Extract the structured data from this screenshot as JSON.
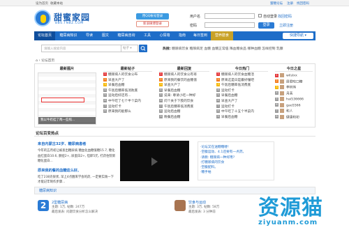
{
  "topbar": {
    "set_home": "设为首页",
    "bookmark": "收藏本站",
    "right_links": [
      "蜜糖论坛",
      "注册",
      "找回密码"
    ]
  },
  "logo": {
    "title": "甜蜜家园",
    "subtitle": "BBS.TNBZ.COM"
  },
  "login": {
    "qq_label": "用QQ帐号登录",
    "weibo_label": "新浪微博登录",
    "user_label": "用户名",
    "pass_label": "密码",
    "user_placeholder": "",
    "pass_placeholder": "",
    "auto_login": "自动登录",
    "forgot": "找回密码",
    "login_btn": "登录",
    "register": "立即注册"
  },
  "nav": {
    "items": [
      "论坛首页",
      "糖尿病知识",
      "导读",
      "图文",
      "糖尿病咨询",
      "工具",
      "心情墙",
      "指南",
      "每日签到",
      "营养膳食"
    ],
    "quick": "快捷导航 ▾"
  },
  "search": {
    "placeholder": "请输入搜索内容",
    "select": "帖子 ▾",
    "hot_label": "热搜:",
    "hot_words": [
      "糖尿病饮食",
      "糖尿病足",
      "血糖",
      "血糖正常值",
      "降血糖食品",
      "哪种血糖",
      "怎样控制",
      "乳腺"
    ]
  },
  "breadcrumb": [
    "首页",
    "论坛首页"
  ],
  "columns": {
    "latest_photos": {
      "title": "最新图片",
      "caption": "我以牛奶挂了两一些照...",
      "highlight": "乳腺癌患者 外出旅行饮食"
    },
    "latest_posts": {
      "title": "最新帖子",
      "items": [
        "糖尿病人的饮食公布",
        "早查大产了",
        "早餐后血糖",
        "午饭后糖率低消败底",
        "运动后好还有...",
        "中午吃了七个半个菜内",
        "运动打卡",
        "原来我的能那么"
      ]
    },
    "latest_replies": {
      "title": "最新回复",
      "items": [
        "糖尿病人的饮食公有哥",
        "原来我的餐饮的血糖值",
        "早查大产了",
        "早餐后血糖",
        "说来: 尊请小吃一种好",
        "问个关于下肢的饮食",
        "午饭后糖率低消费底",
        "运动后血糖",
        "晚餐后血糖"
      ]
    },
    "today_hot": {
      "title": "今日热门",
      "items": [
        "糖尿病人的饮食血糖活",
        "原来这是日是最好懂吧",
        "午饭后糖率低消费底",
        "运动打卡",
        "早餐后血糖",
        "早查大产了",
        "运动打卡",
        "中午吃了十五个半菜内",
        "早餐后血糖"
      ]
    },
    "today_stars": {
      "title": "今日之星",
      "items": [
        "wilslxx",
        "眉君吃口糖",
        "李树伟",
        "月英",
        "hai536666",
        "gao5566",
        "和人",
        "健康和初"
      ]
    }
  },
  "news": {
    "section_title": "论坛百变热点",
    "headline1": "来自内蒙古32岁、糖尿病患者",
    "body1": "今年的五月初让被查出糖尿病 糖血化血糖值糖15.7, 糖化血红蛋白10.6, 酮症2+, 尿蛋白2+, 但即5元, 打药住院新糖化蛋白...",
    "headline2": "原来我的餐的血糖这么好,",
    "body2": "吃了238克很状, 早上4点醒来学会的药, 一定要实践一下才能记牢制作步骤...",
    "related": [
      "·论坛又在送糖糖喽!",
      "·空腹运动、4.1还要有一点药。",
      "·请教: 糖尿病一种好用?",
      "·打糖尿病的饮食",
      "·空腹配料。",
      "·糖手帕"
    ]
  },
  "bottom": {
    "section_title": "糖尿病知识",
    "card1": {
      "title": "2型糖尿病",
      "stats": "主题: 1万, 帖数: 247万",
      "last": "最后发表: 问题饮食分析怎么解决"
    },
    "card2": {
      "title": "饮食与运动",
      "stats": "主题: 3万, 帖数: 58万",
      "last": "最后发表: 3 分钟前"
    }
  },
  "watermark": {
    "big": "资源猫",
    "small": "ziyuanm.com"
  },
  "colors": {
    "brand": "#1e6dc8",
    "nav_highlight": "#c9a227",
    "watermark": "#1f9bd7"
  }
}
